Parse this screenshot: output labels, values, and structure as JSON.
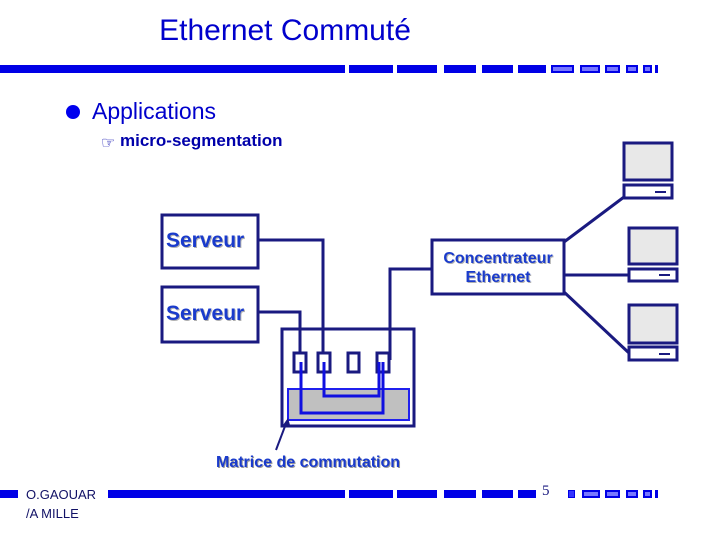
{
  "slide": {
    "title": "Ethernet Commuté",
    "page_number": "5",
    "author_line1": "O.GAOUAR",
    "author_line2": "/A MILLE"
  },
  "content": {
    "heading": "Applications",
    "subheading": "micro-segmentation",
    "bullet_icon": "filled-circle-bullet",
    "sub_bullet_icon": "pointing-hand"
  },
  "diagram": {
    "servers": [
      {
        "label": "Serveur",
        "connects_to_port": 2
      },
      {
        "label": "Serveur",
        "connects_to_port": 1
      }
    ],
    "hub": {
      "label_line1": "Concentrateur",
      "label_line2": "Ethernet",
      "connects_to_port": 4
    },
    "switch": {
      "ports": 4,
      "matrix_label": "Matrice de commutation"
    },
    "computers": [
      {
        "name": "pc-1",
        "connected_to": "hub"
      },
      {
        "name": "pc-2",
        "connected_to": "hub"
      },
      {
        "name": "pc-3",
        "connected_to": "hub"
      }
    ],
    "switch_connections": [
      {
        "from_port": 1,
        "to_port": 4
      },
      {
        "from_port": 2,
        "to_port": 4
      }
    ]
  },
  "colors": {
    "title": "#0000cc",
    "bar": "#0000e6",
    "line": "#1a1a80",
    "matrix_fill": "#c0c0c0",
    "matrix_wire": "#1010e0",
    "monitor_fill": "#e8e8e8"
  }
}
